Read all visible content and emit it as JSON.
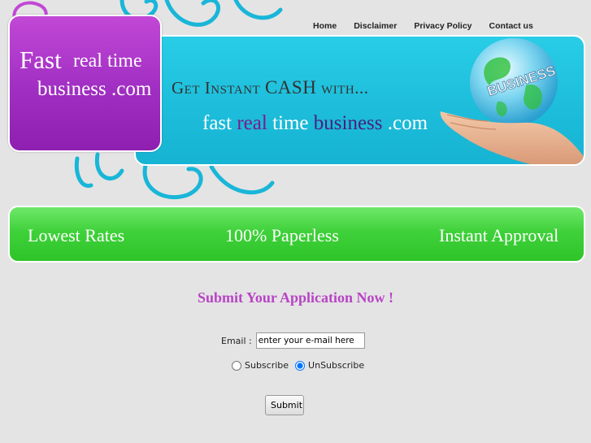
{
  "nav": {
    "home": "Home",
    "disclaimer": "Disclaimer",
    "privacy": "Privacy Policy",
    "contact": "Contact us"
  },
  "logo": {
    "line1": "Fast",
    "line2": "real time",
    "line3": "business .com"
  },
  "banner": {
    "tag_prefix": "Get Instant ",
    "tag_cash": "CASH",
    "tag_suffix": " with...",
    "site_fast": "fast ",
    "site_real": "real",
    "site_time": " time ",
    "site_business": "business",
    "site_com": " .com",
    "globe_label": "BUSINESS"
  },
  "features": {
    "item1": "Lowest Rates",
    "item2": "100% Paperless",
    "item3": "Instant Approval"
  },
  "form": {
    "heading": "Submit Your Application Now !",
    "email_label": "Email :",
    "email_value": "enter your e-mail here",
    "subscribe_label": "Subscribe",
    "unsubscribe_label": "UnSubscribe",
    "selected_option": "UnSubscribe",
    "submit_label": "Submit"
  },
  "colors": {
    "logo_purple": "#a02ec2",
    "banner_cyan": "#1cbcda",
    "feature_green": "#3fd13a",
    "heading_purple": "#b844c6",
    "swirl_cyan": "#19b6d8"
  }
}
